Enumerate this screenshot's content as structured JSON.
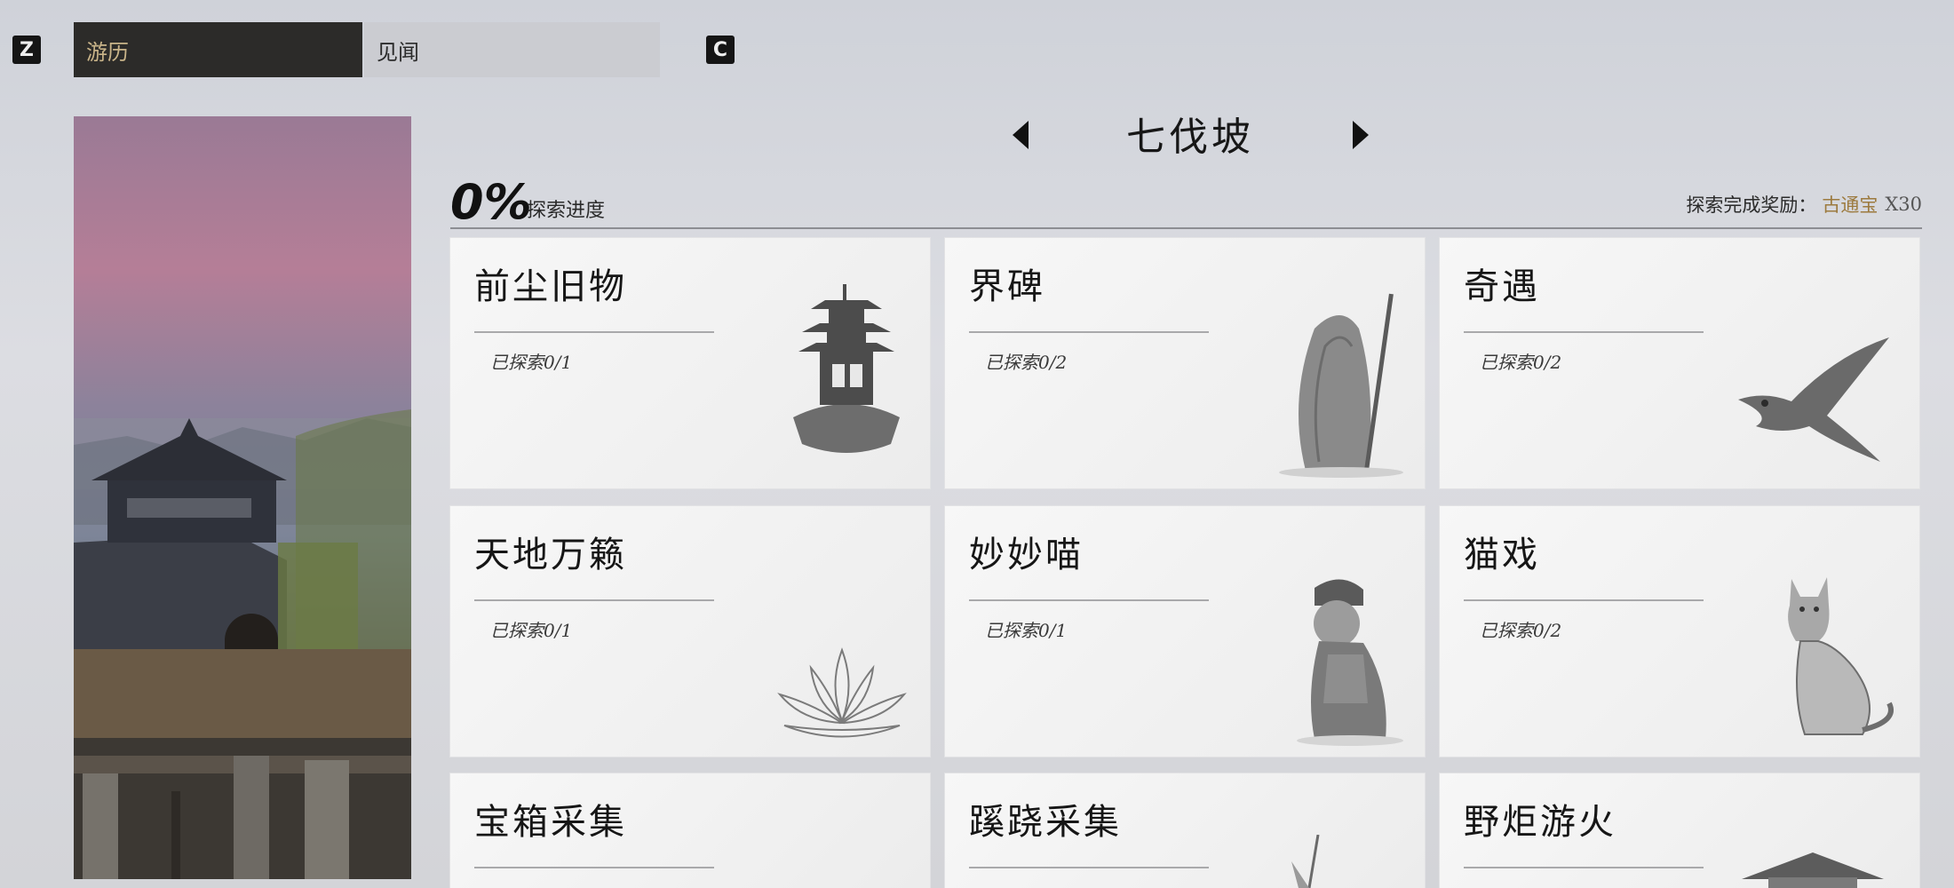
{
  "tabs": {
    "left_key": "Z",
    "right_key": "C",
    "items": [
      {
        "label": "游历",
        "active": true
      },
      {
        "label": "见闻",
        "active": false
      }
    ]
  },
  "region": {
    "name": "七伐坡"
  },
  "progress": {
    "percent": "0%",
    "label": "探索进度"
  },
  "reward": {
    "label": "探索完成奖励：",
    "item": "古通宝",
    "count": "X30"
  },
  "cards": [
    {
      "title": "前尘旧物",
      "count": "已探索0/1",
      "icon": "pagoda-icon"
    },
    {
      "title": "界碑",
      "count": "已探索0/2",
      "icon": "boundary-stone-icon"
    },
    {
      "title": "奇遇",
      "count": "已探索0/2",
      "icon": "swallow-icon"
    },
    {
      "title": "天地万籁",
      "count": "已探索0/1",
      "icon": "lotus-icon"
    },
    {
      "title": "妙妙喵",
      "count": "已探索0/1",
      "icon": "dressed-cat-icon"
    },
    {
      "title": "猫戏",
      "count": "已探索0/2",
      "icon": "cat-icon"
    },
    {
      "title": "宝箱采集",
      "count": "",
      "icon": ""
    },
    {
      "title": "蹊跷采集",
      "count": "",
      "icon": "spear-icon"
    },
    {
      "title": "野炬游火",
      "count": "",
      "icon": "roof-icon"
    }
  ]
}
